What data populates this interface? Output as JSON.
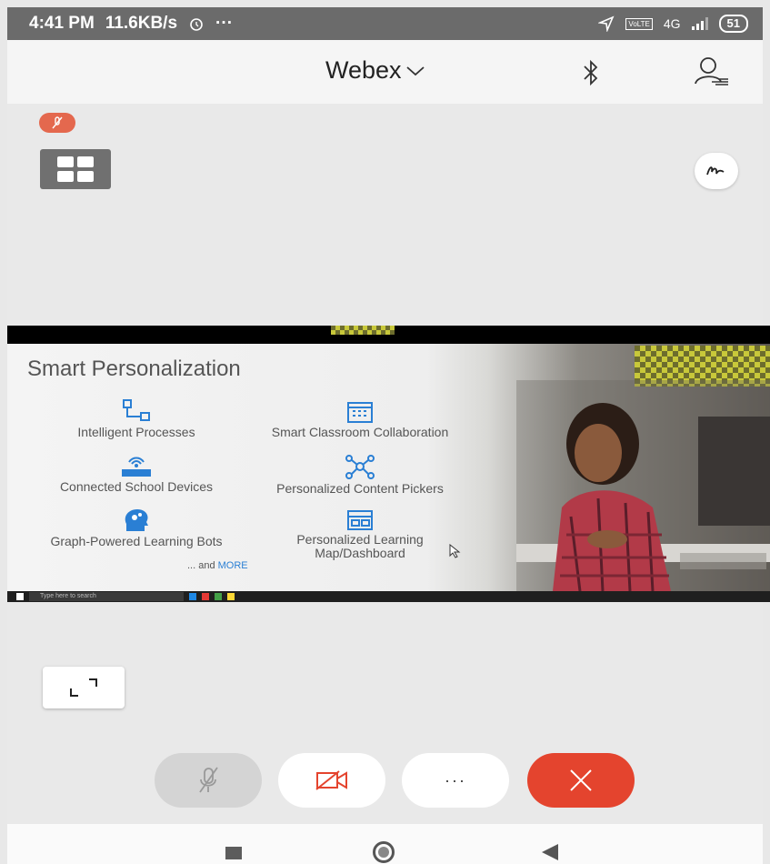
{
  "status_bar": {
    "time": "4:41 PM",
    "speed": "11.6KB/s",
    "more": "···",
    "network_type": "4G",
    "sim_label": "VoLTE",
    "battery": "51"
  },
  "header": {
    "title": "Webex",
    "icons": [
      "chevron-down-icon",
      "bluetooth-icon",
      "participants-icon"
    ]
  },
  "meeting": {
    "muted_badge_icon": "mic-muted-icon",
    "layout_icon": "grid-icon",
    "annotate_icon": "annotate-icon"
  },
  "shared_screen": {
    "slide_title": "Smart Personalization",
    "features": [
      {
        "label": "Intelligent Processes",
        "icon": "process-icon"
      },
      {
        "label": "Smart Classroom Collaboration",
        "icon": "calendar-icon"
      },
      {
        "label": "Connected School Devices",
        "icon": "router-icon"
      },
      {
        "label": "Personalized Content Pickers",
        "icon": "nodes-icon"
      },
      {
        "label": "Graph-Powered Learning Bots",
        "icon": "head-gears-icon"
      },
      {
        "label": "Personalized Learning Map/Dashboard",
        "icon": "dashboard-icon"
      }
    ],
    "and_more_prefix": "... and ",
    "and_more_link": "MORE",
    "taskbar_search": "Type here to search"
  },
  "controls": {
    "mute_icon": "mic-off-icon",
    "video_icon": "video-off-icon",
    "more_label": "···",
    "end_icon": "close-icon"
  },
  "colors": {
    "end_call": "#e4442e",
    "muted_badge": "#e4684e",
    "accent_link": "#2a7fd4"
  }
}
